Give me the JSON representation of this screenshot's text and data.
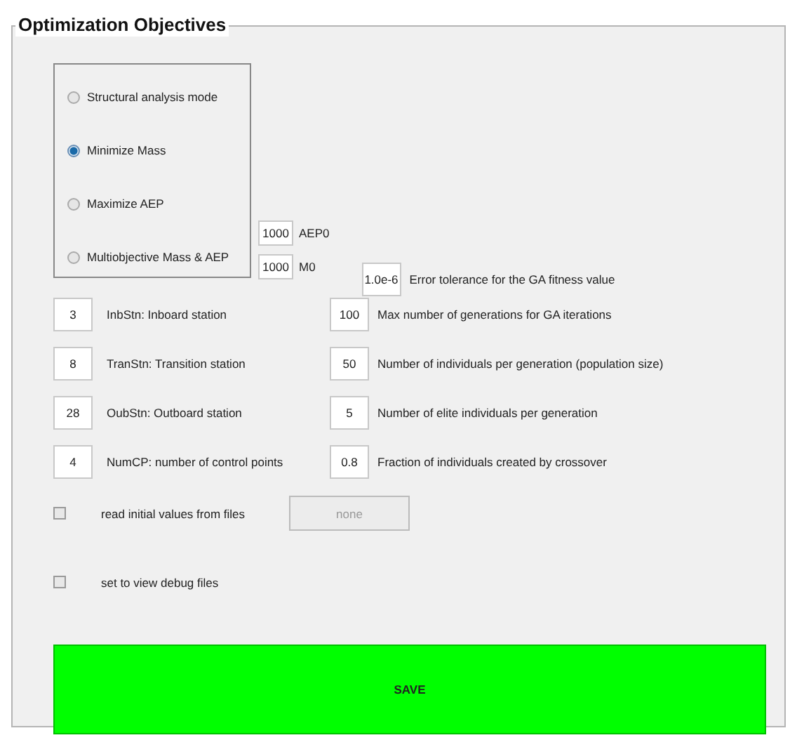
{
  "panel": {
    "title": "Optimization Objectives"
  },
  "modes": [
    {
      "label": "Structural analysis mode",
      "selected": false
    },
    {
      "label": "Minimize Mass",
      "selected": true
    },
    {
      "label": "Maximize AEP",
      "selected": false
    },
    {
      "label": "Multiobjective Mass & AEP",
      "selected": false
    }
  ],
  "references": [
    {
      "value": "1000",
      "label": "AEP0"
    },
    {
      "value": "1000",
      "label": "M0"
    }
  ],
  "stations": [
    {
      "value": "3",
      "label": "InbStn: Inboard station"
    },
    {
      "value": "8",
      "label": "TranStn: Transition station"
    },
    {
      "value": "28",
      "label": "OubStn: Outboard station"
    },
    {
      "value": "4",
      "label": "NumCP: number of control points"
    }
  ],
  "ga_settings": [
    {
      "value": "1.0e-6",
      "label": "Error tolerance for the GA fitness value"
    },
    {
      "value": "100",
      "label": "Max number of generations for GA iterations"
    },
    {
      "value": "50",
      "label": "Number of individuals per generation (population size)"
    },
    {
      "value": "5",
      "label": "Number of elite individuals per generation"
    },
    {
      "value": "0.8",
      "label": "Fraction of individuals created by crossover"
    }
  ],
  "options": [
    {
      "label": "read initial values from files",
      "checked": false,
      "file_button": "none"
    },
    {
      "label": "set to view debug files",
      "checked": false
    }
  ],
  "save_button": "SAVE"
}
